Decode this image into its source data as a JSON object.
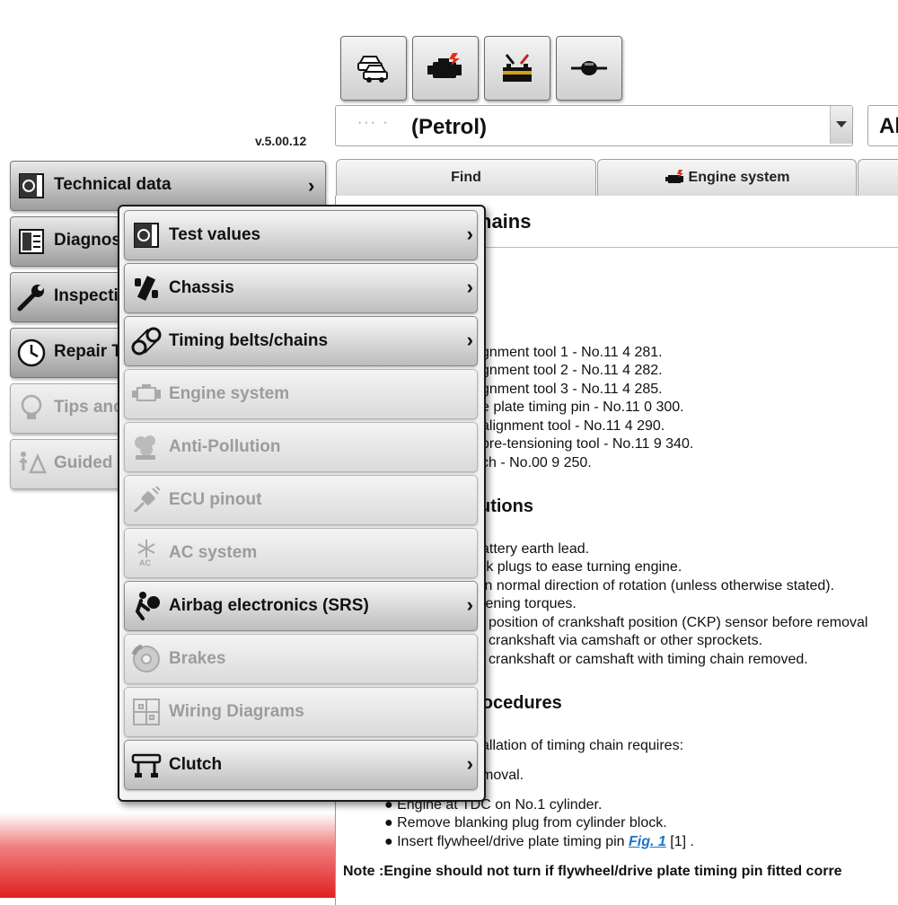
{
  "version": "v.5.00.12",
  "toolbar": {
    "buttons": [
      {
        "icon": "cars-icon"
      },
      {
        "icon": "engine-icon"
      },
      {
        "icon": "battery-tools-icon"
      },
      {
        "icon": "connector-icon"
      }
    ]
  },
  "vehicle_select": {
    "masked": "··· ·",
    "value": "(Petrol)"
  },
  "second_select": {
    "value": "Al"
  },
  "tabs": [
    {
      "label": "Find"
    },
    {
      "label": "Engine system"
    }
  ],
  "left_nav": [
    {
      "label": "Technical data",
      "icon": "technical-data-icon",
      "enabled": true
    },
    {
      "label": "Diagnos",
      "icon": "diagnostics-icon",
      "enabled": true
    },
    {
      "label": "Inspecti",
      "icon": "wrench-icon",
      "enabled": true
    },
    {
      "label": "Repair T",
      "icon": "clock-icon",
      "enabled": true
    },
    {
      "label": "Tips and",
      "icon": "lightbulb-icon",
      "enabled": false
    },
    {
      "label": "Guided",
      "icon": "guided-icon",
      "enabled": false
    }
  ],
  "submenu": [
    {
      "label": "Test values",
      "icon": "test-values-icon",
      "enabled": true,
      "arrow": true
    },
    {
      "label": "Chassis",
      "icon": "chassis-icon",
      "enabled": true,
      "arrow": true
    },
    {
      "label": "Timing belts/chains",
      "icon": "timing-belt-icon",
      "enabled": true,
      "arrow": true
    },
    {
      "label": "Engine system",
      "icon": "engine-icon",
      "enabled": false,
      "arrow": false
    },
    {
      "label": "Anti-Pollution",
      "icon": "anti-pollution-icon",
      "enabled": false,
      "arrow": false
    },
    {
      "label": "ECU pinout",
      "icon": "plug-icon",
      "enabled": false,
      "arrow": false
    },
    {
      "label": "AC system",
      "icon": "snowflake-icon",
      "enabled": false,
      "arrow": false
    },
    {
      "label": "Airbag electronics (SRS)",
      "icon": "airbag-icon",
      "enabled": true,
      "arrow": true
    },
    {
      "label": "Brakes",
      "icon": "brake-disc-icon",
      "enabled": false,
      "arrow": false
    },
    {
      "label": "Wiring Diagrams",
      "icon": "wiring-icon",
      "enabled": false,
      "arrow": false
    },
    {
      "label": "Clutch",
      "icon": "clutch-icon",
      "enabled": true,
      "arrow": true
    }
  ],
  "ac_badge": "AC",
  "content": {
    "heading1": "hains",
    "tools": [
      "gnment tool 1 - No.11 4 281.",
      "gnment tool 2 - No.11 4 282.",
      "gnment tool 3 - No.11 4 285.",
      "e plate timing pin - No.11 0 300.",
      "alignment tool - No.11 4 290.",
      "pre-tensioning tool - No.11 9 340.",
      "ch - No.00 9 250."
    ],
    "heading2": "utions",
    "precautions": [
      "attery earth lead.",
      "rk plugs to ease turning engine.",
      "in normal direction of rotation (unless otherwise stated).",
      "tening torques.",
      "position of crankshaft position (CKP) sensor before removal",
      "crankshaft via camshaft or other sprockets.",
      "crankshaft or camshaft with timing chain removed."
    ],
    "heading3": "rocedures",
    "proc_line1": "allation of timing chain requires:",
    "proc_line2": "moval.",
    "bullets": [
      "Engine at TDC on No.1 cylinder.",
      "Remove blanking plug from cylinder block.",
      "Insert flywheel/drive plate timing pin"
    ],
    "fig_link": "Fig. 1",
    "fig_ref": "[1] .",
    "note": "Note :Engine should not turn if flywheel/drive plate timing pin fitted corre"
  }
}
